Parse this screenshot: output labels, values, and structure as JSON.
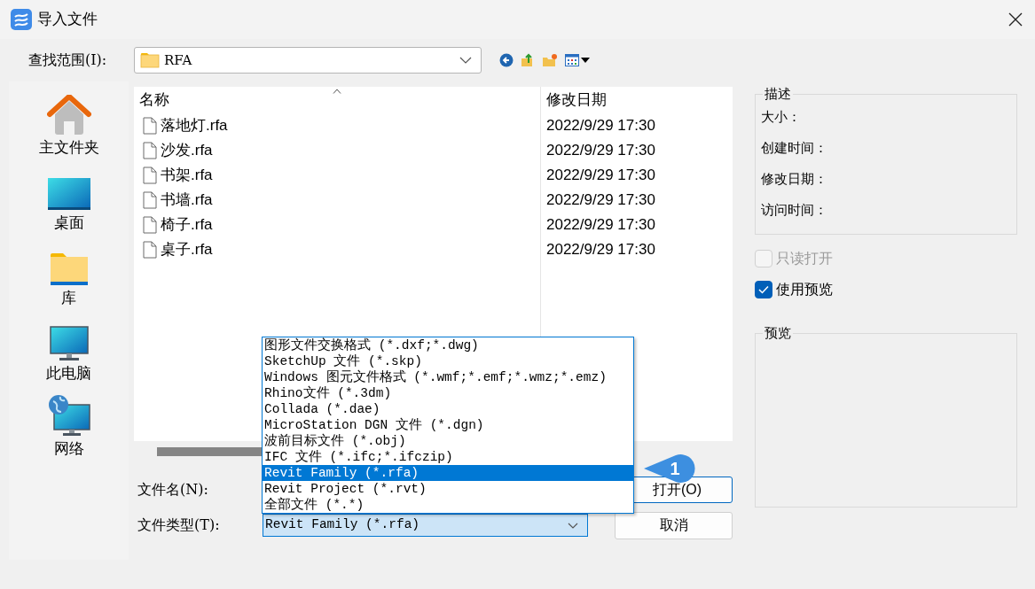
{
  "window": {
    "title": "导入文件"
  },
  "look_in": {
    "label": "查找范围(I):",
    "value": "RFA"
  },
  "places": [
    {
      "label": "主文件夹",
      "kind": "home"
    },
    {
      "label": "桌面",
      "kind": "desktop"
    },
    {
      "label": "库",
      "kind": "library"
    },
    {
      "label": "此电脑",
      "kind": "computer"
    },
    {
      "label": "网络",
      "kind": "network"
    }
  ],
  "file_list": {
    "columns": [
      "名称",
      "修改日期"
    ],
    "rows": [
      {
        "name": "落地灯.rfa",
        "modified": "2022/9/29 17:30"
      },
      {
        "name": "沙发.rfa",
        "modified": "2022/9/29 17:30"
      },
      {
        "name": "书架.rfa",
        "modified": "2022/9/29 17:30"
      },
      {
        "name": "书墙.rfa",
        "modified": "2022/9/29 17:30"
      },
      {
        "name": "椅子.rfa",
        "modified": "2022/9/29 17:30"
      },
      {
        "name": "桌子.rfa",
        "modified": "2022/9/29 17:30"
      }
    ]
  },
  "description": {
    "title": "描述",
    "fields": [
      "大小：",
      "创建时间：",
      "修改日期：",
      "访问时间："
    ]
  },
  "options": [
    {
      "label": "只读打开",
      "checked": false,
      "disabled": true
    },
    {
      "label": "使用预览",
      "checked": true,
      "disabled": false
    }
  ],
  "preview": {
    "title": "预览"
  },
  "file_name": {
    "label": "文件名(N):"
  },
  "file_type": {
    "label": "文件类型(T):",
    "value": "Revit Family (*.rfa)",
    "options": [
      {
        "label": "图形文件交换格式 (*.dxf;*.dwg)",
        "selected": false
      },
      {
        "label": "SketchUp 文件 (*.skp)",
        "selected": false
      },
      {
        "label": "Windows 图元文件格式 (*.wmf;*.emf;*.wmz;*.emz)",
        "selected": false
      },
      {
        "label": "Rhino文件 (*.3dm)",
        "selected": false
      },
      {
        "label": "Collada (*.dae)",
        "selected": false
      },
      {
        "label": "MicroStation DGN 文件 (*.dgn)",
        "selected": false
      },
      {
        "label": "波前目标文件 (*.obj)",
        "selected": false
      },
      {
        "label": "IFC 文件 (*.ifc;*.ifczip)",
        "selected": false
      },
      {
        "label": "Revit Family (*.rfa)",
        "selected": true
      },
      {
        "label": "Revit Project (*.rvt)",
        "selected": false
      },
      {
        "label": "全部文件 (*.*)",
        "selected": false
      }
    ]
  },
  "buttons": [
    {
      "label": "打开(O)",
      "kind": "primary"
    },
    {
      "label": "取消",
      "kind": "secondary"
    }
  ],
  "callout": {
    "label": "1"
  }
}
